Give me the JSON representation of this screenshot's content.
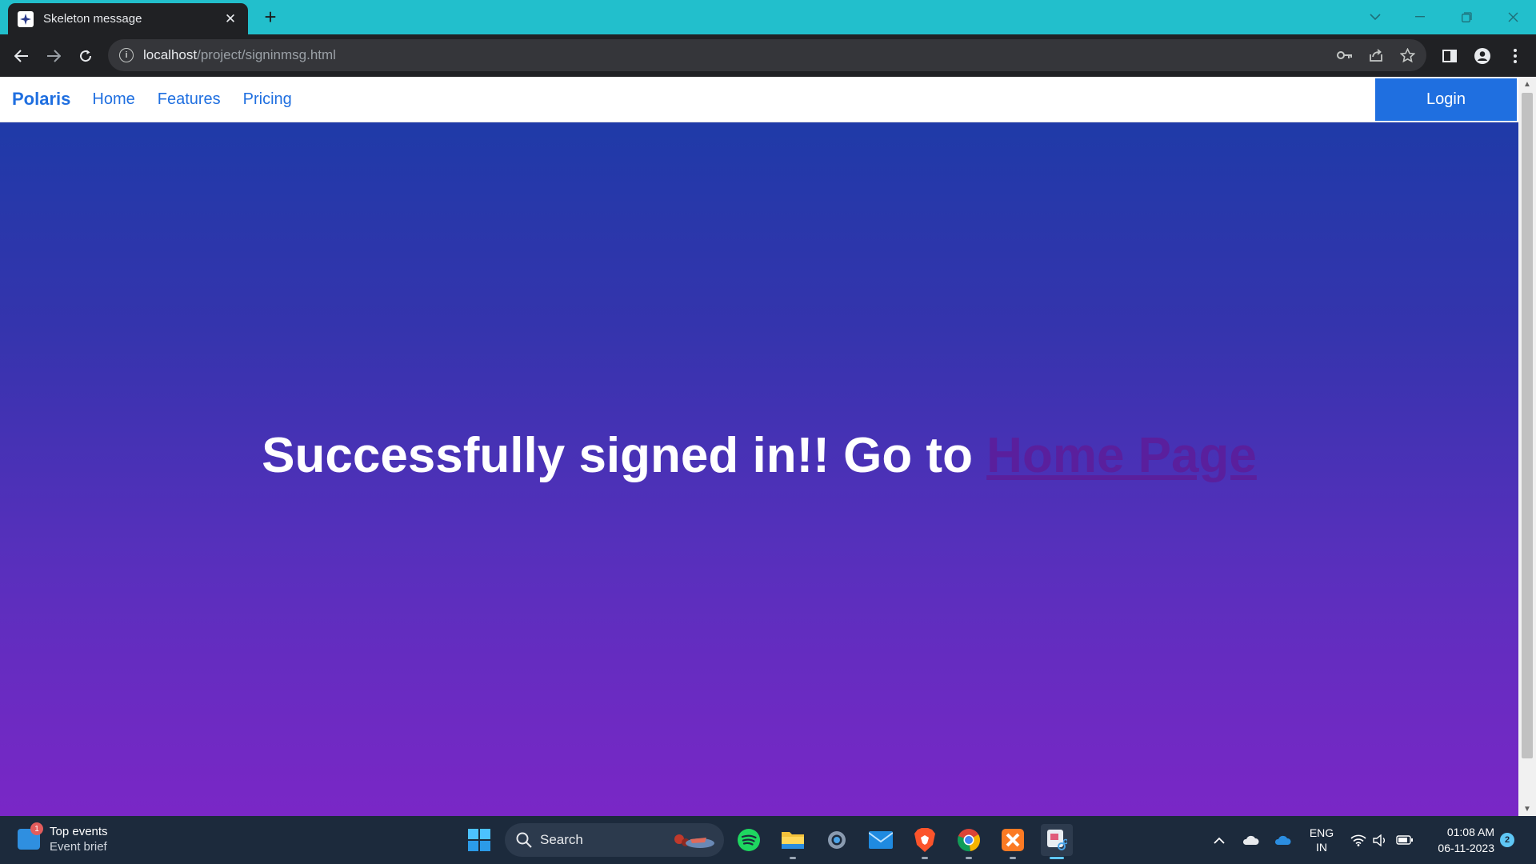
{
  "browser": {
    "tab_title": "Skeleton message",
    "tab_close": "✕",
    "new_tab": "+",
    "url_host": "localhost",
    "url_path": "/project/signinmsg.html"
  },
  "page": {
    "brand": "Polaris",
    "nav": [
      "Home",
      "Features",
      "Pricing"
    ],
    "login": "Login",
    "hero_text": "Successfully signed in!! Go to ",
    "hero_link": "Home Page",
    "accent_color": "#1f6fe0",
    "link_color": "#5a1f9d"
  },
  "taskbar": {
    "widget_title": "Top events",
    "widget_subtitle": "Event brief",
    "widget_badge": "1",
    "search_label": "Search",
    "language": "ENG",
    "region": "IN",
    "time": "01:08 AM",
    "date": "06-11-2023",
    "notification_count": "2"
  }
}
